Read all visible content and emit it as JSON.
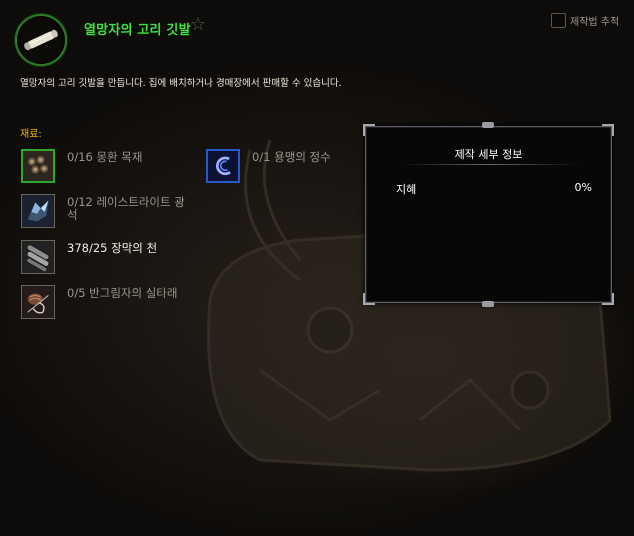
{
  "header": {
    "title": "열망자의 고리 깃발",
    "icon": "rolled-banner-icon",
    "track_label": "제작법 추적"
  },
  "description": "열망자의 고리 깃발을 만듭니다. 집에 배치하거나 경매장에서 판매할 수 있습니다.",
  "reagents": {
    "heading": "재료:",
    "items": [
      {
        "text": "0/16 몽환 목재",
        "icon": "log-pile-icon",
        "have": false
      },
      {
        "text": "0/1 용맹의 정수",
        "icon": "swirl-essence-icon",
        "have": false
      },
      {
        "text": "0/12 레이스트라이트 광석",
        "icon": "ore-crystal-icon",
        "have": false
      },
      {
        "text": "378/25 장막의 천",
        "icon": "cloth-bolt-icon",
        "have": true
      },
      {
        "text": "0/5 반그림자의 실타래",
        "icon": "thread-spool-icon",
        "have": false
      }
    ]
  },
  "details": {
    "title": "제작 세부 정보",
    "stat_name": "지혜",
    "stat_value": "0%"
  },
  "colors": {
    "title_green": "#40e040",
    "heading_gold": "#e8b800",
    "quality_green": "#2fa82a",
    "quality_blue": "#2a58c8"
  }
}
